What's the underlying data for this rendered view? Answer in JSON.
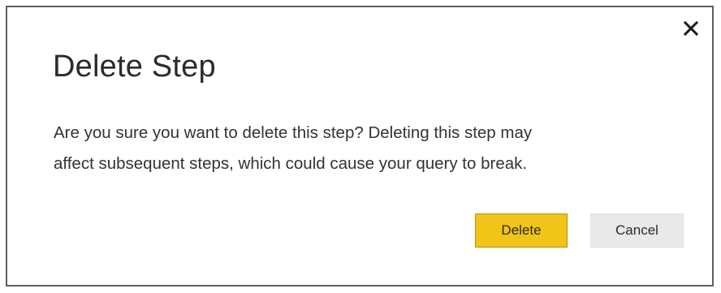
{
  "dialog": {
    "title": "Delete Step",
    "message_line1": "Are you sure you want to delete this step? Deleting this step may",
    "message_line2": "affect subsequent steps, which could cause your query to break.",
    "close_icon": "close-icon"
  },
  "buttons": {
    "delete_label": "Delete",
    "cancel_label": "Cancel"
  },
  "colors": {
    "primary_button": "#f0c418",
    "secondary_button": "#e9e9e9",
    "border": "#5f5f5f"
  }
}
